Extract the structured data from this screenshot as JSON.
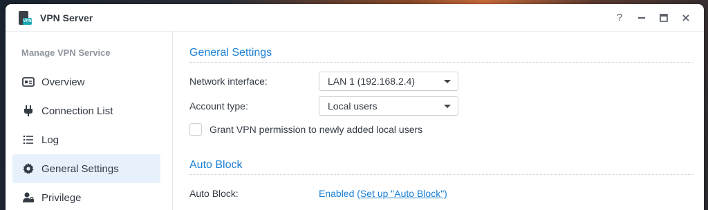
{
  "window": {
    "title": "VPN Server",
    "app_badge": "VPN"
  },
  "controls": {
    "help": "?",
    "minimize": "—",
    "maximize": "□",
    "close": "✕"
  },
  "sidebar": {
    "heading": "Manage VPN Service",
    "items": [
      {
        "label": "Overview",
        "icon": "overview-icon"
      },
      {
        "label": "Connection List",
        "icon": "plug-icon"
      },
      {
        "label": "Log",
        "icon": "list-icon"
      },
      {
        "label": "General Settings",
        "icon": "gear-icon",
        "active": true
      },
      {
        "label": "Privilege",
        "icon": "user-lock-icon"
      }
    ]
  },
  "general": {
    "title": "General Settings",
    "network_label": "Network interface:",
    "network_value": "LAN 1 (192.168.2.4)",
    "account_label": "Account type:",
    "account_value": "Local users",
    "grant_label": "Grant VPN permission to newly added local users"
  },
  "autoblock": {
    "title": "Auto Block",
    "label": "Auto Block:",
    "status": "Enabled",
    "link_text": "(Set up \"Auto Block\")"
  },
  "colors": {
    "accent": "#1a7fd4",
    "active_bg": "#e6f1fb",
    "text": "#333a44"
  }
}
